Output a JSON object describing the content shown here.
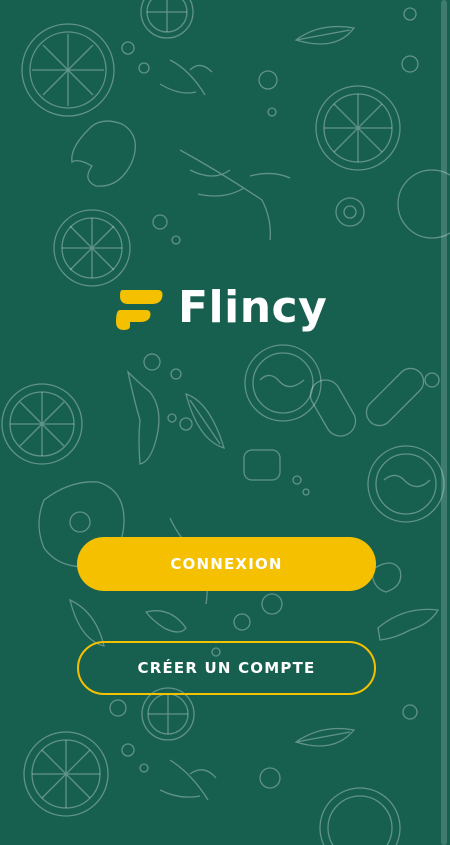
{
  "app": {
    "name": "Flincy",
    "brand_color": "#f5c000",
    "background_color": "#17604f"
  },
  "actions": {
    "login_label": "CONNEXION",
    "signup_label": "CRÉER UN COMPTE"
  },
  "icons": {
    "logo": "flincy-f-logo-icon",
    "background": "food-doodle-pattern"
  }
}
